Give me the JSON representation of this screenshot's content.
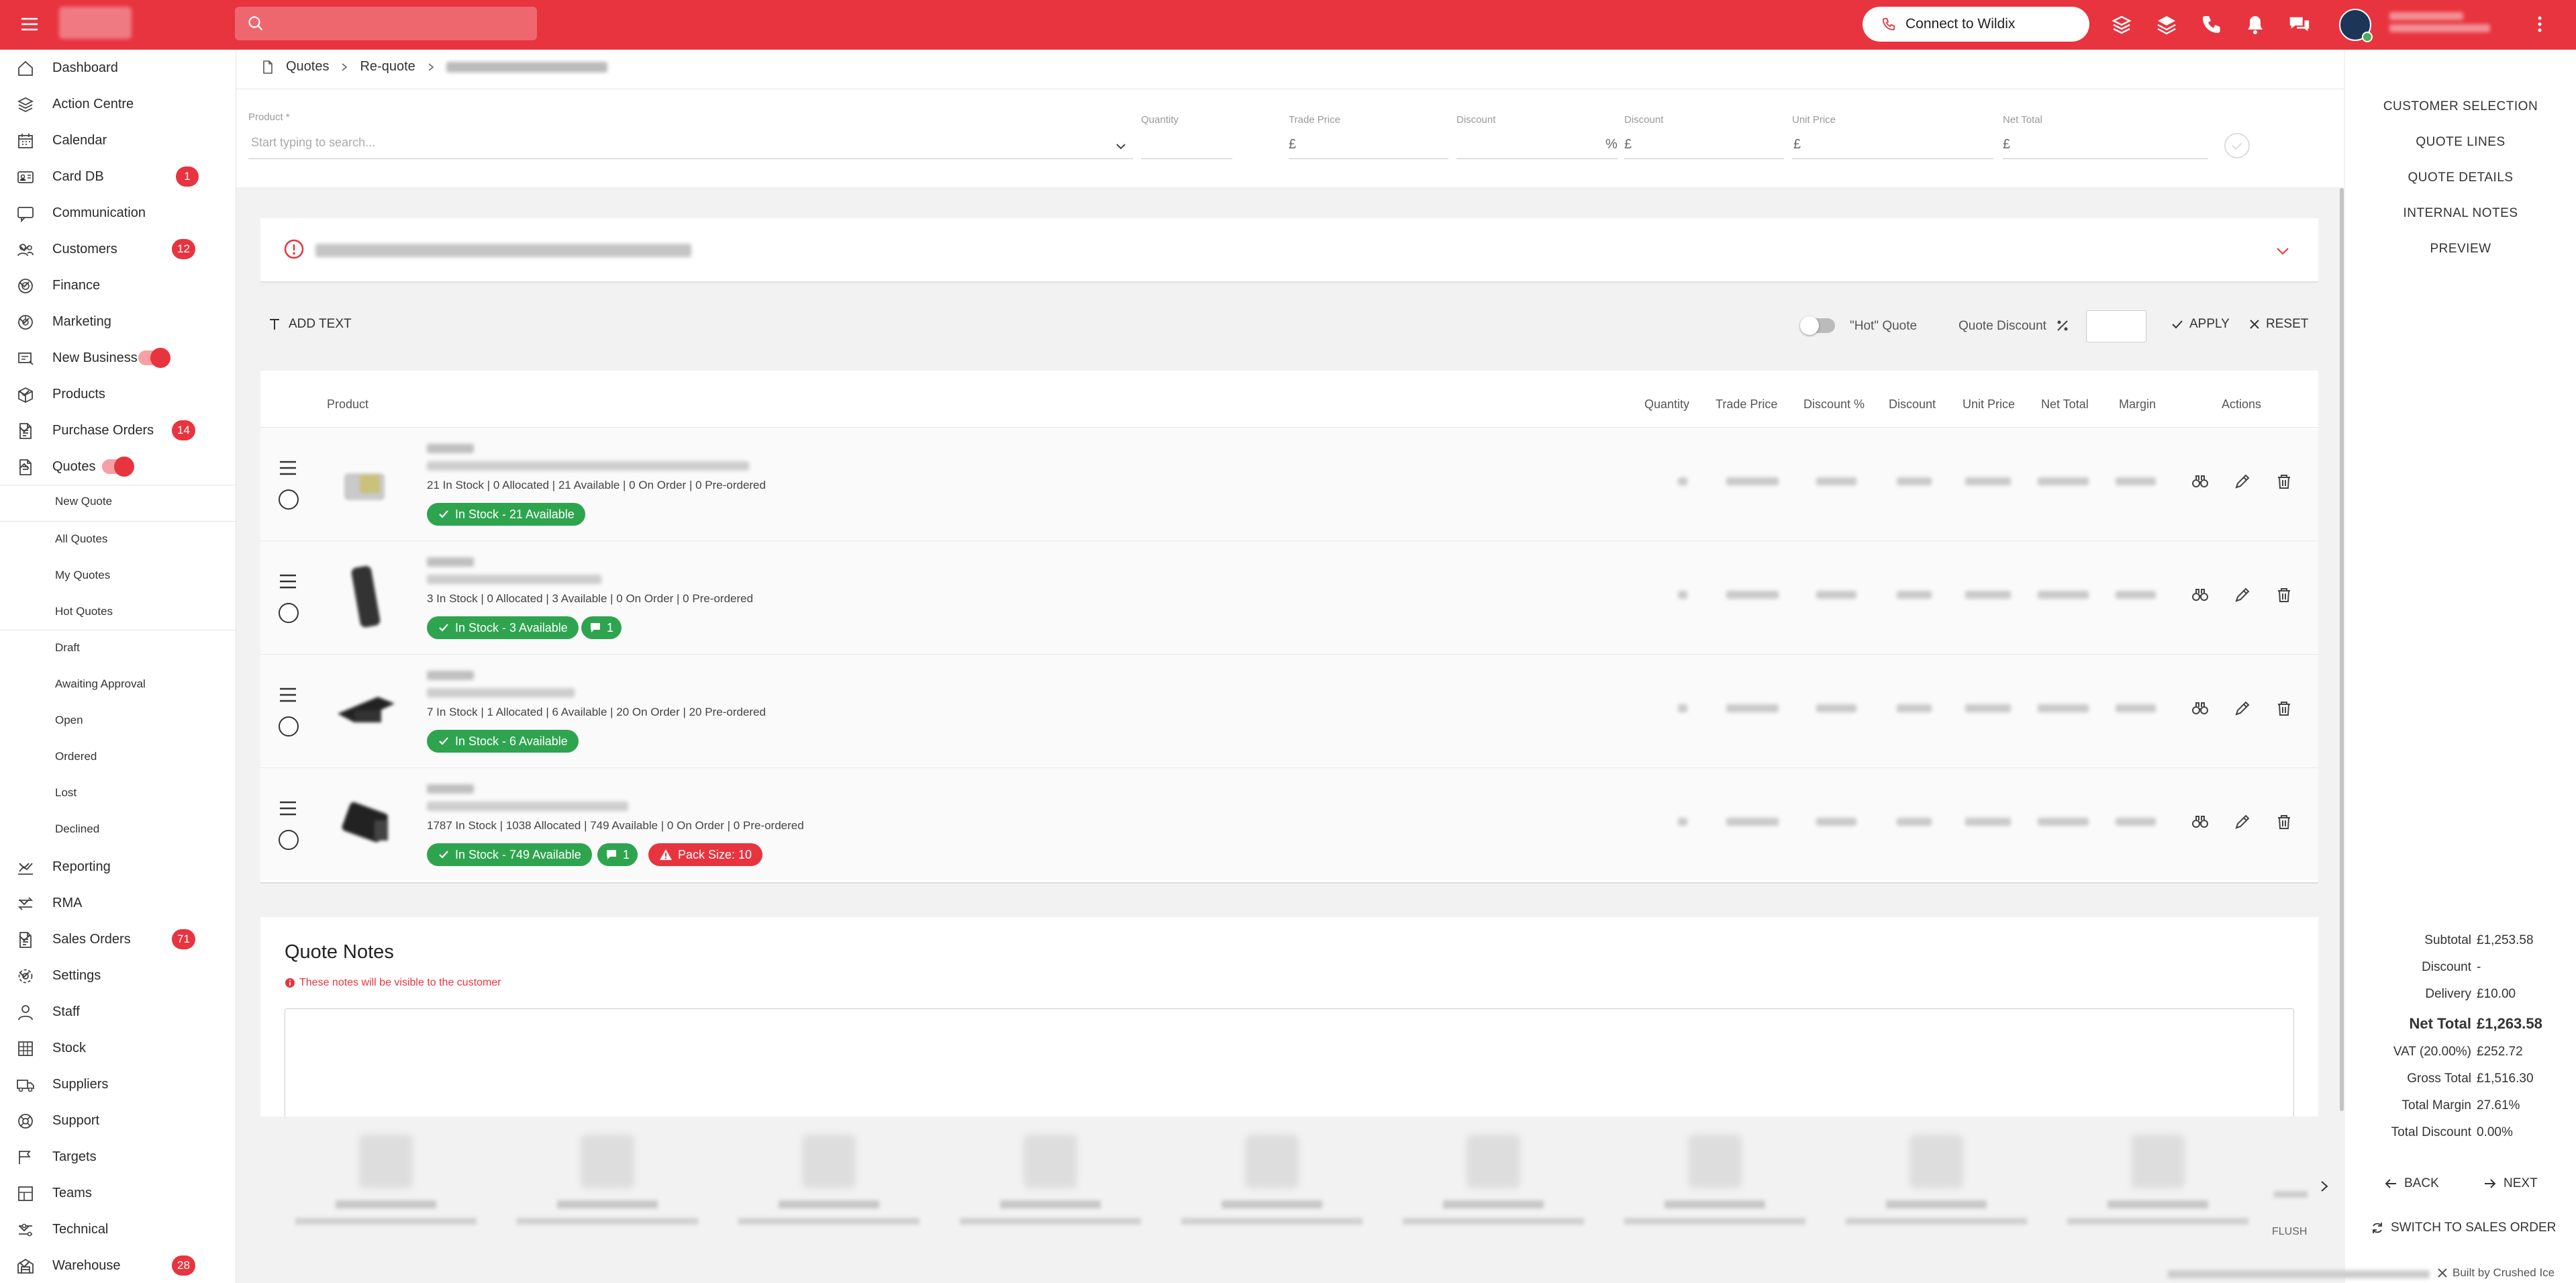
{
  "header": {
    "connect_label": "Connect to Wildix",
    "search_placeholder": ""
  },
  "sidebar": {
    "items": [
      {
        "key": "dashboard",
        "label": "Dashboard",
        "icon": "home-icon"
      },
      {
        "key": "action-centre",
        "label": "Action Centre",
        "icon": "layers-icon"
      },
      {
        "key": "calendar",
        "label": "Calendar",
        "icon": "calendar-icon"
      },
      {
        "key": "card-db",
        "label": "Card DB",
        "icon": "card-icon",
        "badge": "1"
      },
      {
        "key": "communication",
        "label": "Communication",
        "icon": "chat-icon"
      },
      {
        "key": "customers",
        "label": "Customers",
        "icon": "users-icon",
        "badge": "12",
        "chevron": "down"
      },
      {
        "key": "finance",
        "label": "Finance",
        "icon": "coins-icon",
        "chevron": "down"
      },
      {
        "key": "marketing",
        "label": "Marketing",
        "icon": "megaphone-icon",
        "chevron": "down"
      },
      {
        "key": "new-business",
        "label": "New Business",
        "icon": "handshake-icon",
        "toggle": true
      },
      {
        "key": "products",
        "label": "Products",
        "icon": "box-icon",
        "chevron": "down"
      },
      {
        "key": "purchase-orders",
        "label": "Purchase Orders",
        "icon": "document-icon",
        "badge": "14",
        "chevron": "down"
      },
      {
        "key": "quotes",
        "label": "Quotes",
        "icon": "document-icon",
        "toggle": true,
        "chevron": "up"
      }
    ],
    "quotes_sub": {
      "new_quote": "New Quote",
      "all_quotes": "All Quotes",
      "my_quotes": "My Quotes",
      "hot_quotes": "Hot Quotes",
      "draft": "Draft",
      "awaiting_approval": "Awaiting Approval",
      "open": "Open",
      "ordered": "Ordered",
      "lost": "Lost",
      "declined": "Declined"
    },
    "bottom_items": [
      {
        "key": "reporting",
        "label": "Reporting",
        "icon": "chart-icon",
        "chevron": "down"
      },
      {
        "key": "rma",
        "label": "RMA",
        "icon": "swap-icon",
        "chevron": "down"
      },
      {
        "key": "sales-orders",
        "label": "Sales Orders",
        "icon": "document-icon",
        "badge": "71",
        "chevron": "down"
      },
      {
        "key": "settings",
        "label": "Settings",
        "icon": "gear-icon",
        "chevron": "down"
      },
      {
        "key": "staff",
        "label": "Staff",
        "icon": "person-icon"
      },
      {
        "key": "stock",
        "label": "Stock",
        "icon": "grid-icon"
      },
      {
        "key": "suppliers",
        "label": "Suppliers",
        "icon": "truck-icon"
      },
      {
        "key": "support",
        "label": "Support",
        "icon": "lifebuoy-icon"
      },
      {
        "key": "targets",
        "label": "Targets",
        "icon": "target-icon"
      },
      {
        "key": "teams",
        "label": "Teams",
        "icon": "team-icon"
      },
      {
        "key": "technical",
        "label": "Technical",
        "icon": "wrench-icon",
        "chevron": "down"
      },
      {
        "key": "warehouse",
        "label": "Warehouse",
        "icon": "warehouse-icon",
        "badge": "28",
        "chevron": "down"
      }
    ]
  },
  "breadcrumb": {
    "quotes": "Quotes",
    "requote": "Re-quote"
  },
  "product_bar": {
    "product_label": "Product *",
    "product_placeholder": "Start typing to search...",
    "quantity_label": "Quantity",
    "trade_price_label": "Trade Price",
    "discount_pct_label": "Discount",
    "discount_label": "Discount",
    "unit_price_label": "Unit Price",
    "net_total_label": "Net Total",
    "currency": "£",
    "percent": "%"
  },
  "toolbar": {
    "add_text": "ADD TEXT",
    "hot_quote": "\"Hot\" Quote",
    "quote_discount": "Quote Discount",
    "apply": "APPLY",
    "reset": "RESET"
  },
  "table": {
    "headers": {
      "product": "Product",
      "quantity": "Quantity",
      "trade_price": "Trade Price",
      "discount_pct": "Discount %",
      "discount": "Discount",
      "unit_price": "Unit Price",
      "net_total": "Net Total",
      "margin": "Margin",
      "actions": "Actions"
    },
    "rows": [
      {
        "stock": "21 In Stock | 0 Allocated | 21 Available | 0 On Order | 0 Pre-ordered",
        "badge": "In Stock - 21 Available",
        "comments": null,
        "pack": null
      },
      {
        "stock": "3 In Stock | 0 Allocated | 3 Available | 0 On Order | 0 Pre-ordered",
        "badge": "In Stock - 3 Available",
        "comments": "1",
        "pack": null
      },
      {
        "stock": "7 In Stock | 1 Allocated | 6 Available | 20 On Order | 20 Pre-ordered",
        "badge": "In Stock - 6 Available",
        "comments": null,
        "pack": null
      },
      {
        "stock": "1787 In Stock | 1038 Allocated | 749 Available | 0 On Order | 0 Pre-ordered",
        "badge": "In Stock - 749 Available",
        "comments": "1",
        "pack": "Pack Size: 10"
      }
    ]
  },
  "notes": {
    "title": "Quote Notes",
    "hint": "These notes will be visible to the customer"
  },
  "right_panel": {
    "links": {
      "customer_selection": "CUSTOMER SELECTION",
      "quote_lines": "QUOTE LINES",
      "quote_details": "QUOTE DETAILS",
      "internal_notes": "INTERNAL NOTES",
      "preview": "PREVIEW"
    },
    "summary": {
      "subtotal_label": "Subtotal",
      "subtotal": "£1,253.58",
      "discount_label": "Discount",
      "discount": "-",
      "delivery_label": "Delivery",
      "delivery": "£10.00",
      "net_total_label": "Net Total",
      "net_total": "£1,263.58",
      "vat_label": "VAT (20.00%)",
      "vat": "£252.72",
      "gross_total_label": "Gross Total",
      "gross_total": "£1,516.30",
      "total_margin_label": "Total Margin",
      "total_margin": "27.61%",
      "total_discount_label": "Total Discount",
      "total_discount": "0.00%"
    },
    "back": "BACK",
    "next": "NEXT",
    "switch": "SWITCH TO SALES ORDER"
  },
  "bottom_strip": {
    "flush_label": "FLUSH"
  },
  "footer": {
    "built_by": "Built by Crushed Ice"
  },
  "colors": {
    "brand": "#e8343f",
    "success": "#2fa44f"
  }
}
